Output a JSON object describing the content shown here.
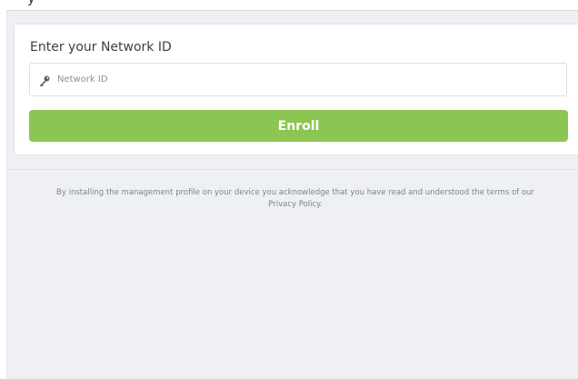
{
  "header": {
    "partial_text": "y"
  },
  "card": {
    "title": "Enter your Network ID",
    "input": {
      "placeholder": "Network ID",
      "value": "",
      "icon": "key-icon"
    },
    "enroll_label": "Enroll"
  },
  "footer": {
    "disclaimer_line1": "By installing the management profile on your device you acknowledge that you have read and understood the terms of our",
    "disclaimer_line2": "Privacy Policy."
  },
  "colors": {
    "accent_green": "#8bc653",
    "panel_background": "#eef0f3"
  }
}
